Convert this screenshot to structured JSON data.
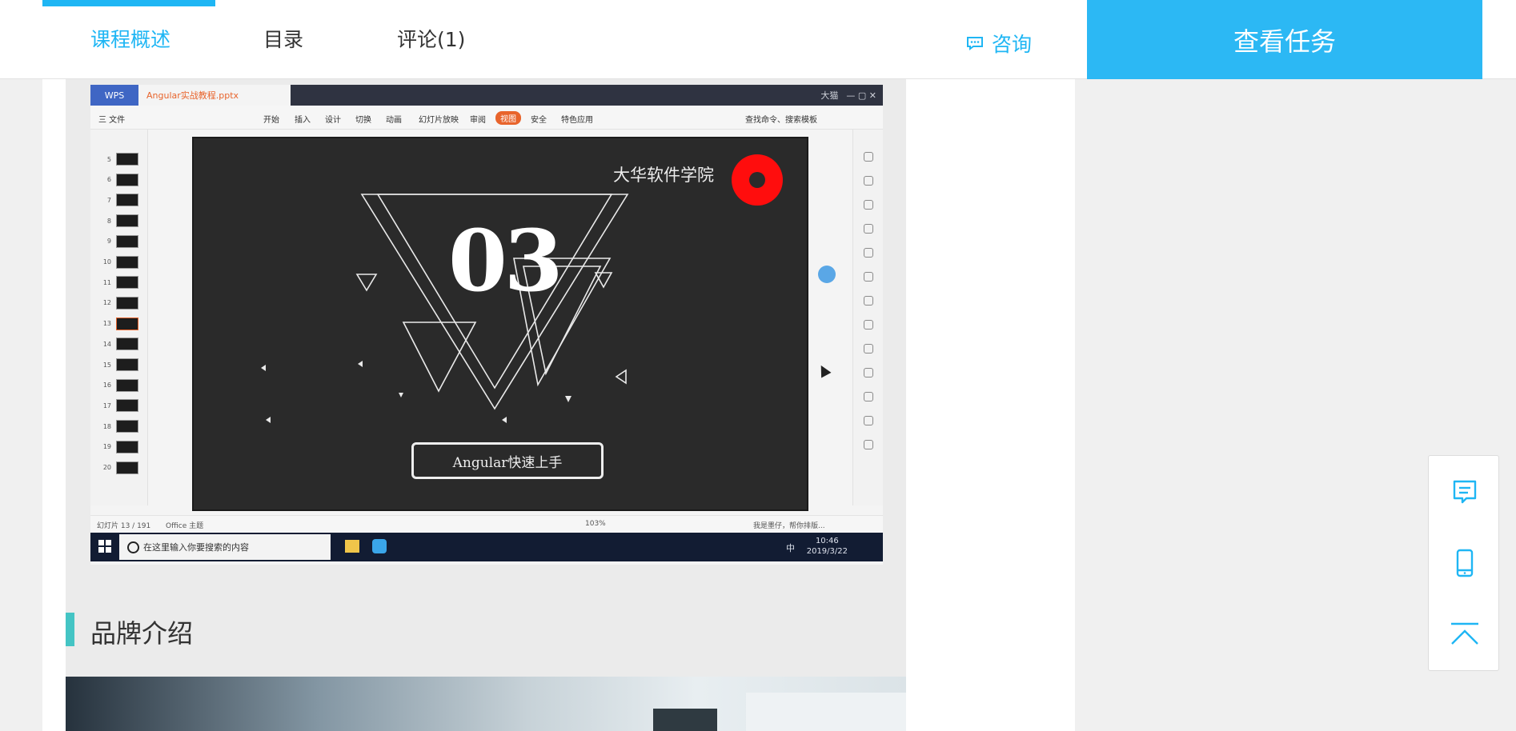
{
  "tabs": [
    {
      "label": "课程概述",
      "active": true
    },
    {
      "label": "目录",
      "active": false
    },
    {
      "label": "评论(1)",
      "active": false
    }
  ],
  "header": {
    "consult_label": "咨询",
    "view_task_label": "查看任务"
  },
  "colors": {
    "accent": "#1fb6f4",
    "button": "#2cb8f4",
    "section_bar": "#44c4c4",
    "wps_orange": "#e8642c"
  },
  "embedded_screenshot": {
    "app_badge": "WPS",
    "file_tab": "Angular实战教程.pptx",
    "title_user": "大猫",
    "menu": {
      "file": "三 文件",
      "items": [
        "开始",
        "插入",
        "设计",
        "切换",
        "动画",
        "幻灯片放映",
        "审阅",
        "视图",
        "安全",
        "特色应用"
      ],
      "highlighted": "视图",
      "search": "查找命令、搜索模板"
    },
    "thumb_numbers": [
      "5",
      "6",
      "7",
      "8",
      "9",
      "10",
      "11",
      "12",
      "13",
      "14",
      "15",
      "16",
      "17",
      "18",
      "19",
      "20"
    ],
    "selected_thumb": "13",
    "slide": {
      "school": "大华软件学院",
      "big_number": "03",
      "banner": "Angular快速上手"
    },
    "status": {
      "slide_count": "幻灯片 13 / 191",
      "theme": "Office 主题",
      "zoom": "103%",
      "assistant": "我是墨仔，帮你排版..."
    },
    "taskbar": {
      "search_placeholder": "在这里输入你要搜索的内容",
      "ime": "中",
      "time": "10:46",
      "date": "2019/3/22"
    }
  },
  "section": {
    "title": "品牌介绍"
  },
  "float_tools": [
    {
      "icon": "message-icon"
    },
    {
      "icon": "mobile-icon"
    },
    {
      "icon": "back-to-top-icon"
    }
  ]
}
